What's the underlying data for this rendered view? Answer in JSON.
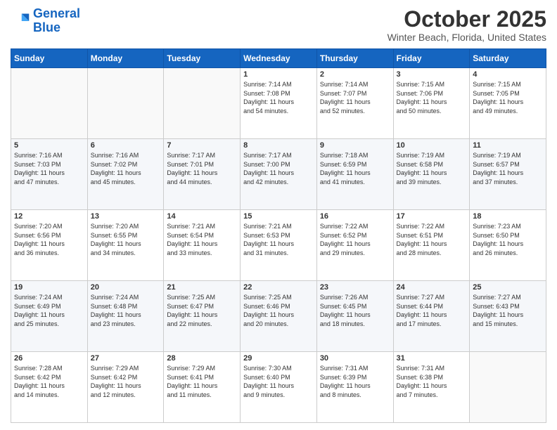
{
  "header": {
    "logo_line1": "General",
    "logo_line2": "Blue",
    "month": "October 2025",
    "location": "Winter Beach, Florida, United States"
  },
  "weekdays": [
    "Sunday",
    "Monday",
    "Tuesday",
    "Wednesday",
    "Thursday",
    "Friday",
    "Saturday"
  ],
  "weeks": [
    [
      {
        "day": "",
        "info": ""
      },
      {
        "day": "",
        "info": ""
      },
      {
        "day": "",
        "info": ""
      },
      {
        "day": "1",
        "info": "Sunrise: 7:14 AM\nSunset: 7:08 PM\nDaylight: 11 hours\nand 54 minutes."
      },
      {
        "day": "2",
        "info": "Sunrise: 7:14 AM\nSunset: 7:07 PM\nDaylight: 11 hours\nand 52 minutes."
      },
      {
        "day": "3",
        "info": "Sunrise: 7:15 AM\nSunset: 7:06 PM\nDaylight: 11 hours\nand 50 minutes."
      },
      {
        "day": "4",
        "info": "Sunrise: 7:15 AM\nSunset: 7:05 PM\nDaylight: 11 hours\nand 49 minutes."
      }
    ],
    [
      {
        "day": "5",
        "info": "Sunrise: 7:16 AM\nSunset: 7:03 PM\nDaylight: 11 hours\nand 47 minutes."
      },
      {
        "day": "6",
        "info": "Sunrise: 7:16 AM\nSunset: 7:02 PM\nDaylight: 11 hours\nand 45 minutes."
      },
      {
        "day": "7",
        "info": "Sunrise: 7:17 AM\nSunset: 7:01 PM\nDaylight: 11 hours\nand 44 minutes."
      },
      {
        "day": "8",
        "info": "Sunrise: 7:17 AM\nSunset: 7:00 PM\nDaylight: 11 hours\nand 42 minutes."
      },
      {
        "day": "9",
        "info": "Sunrise: 7:18 AM\nSunset: 6:59 PM\nDaylight: 11 hours\nand 41 minutes."
      },
      {
        "day": "10",
        "info": "Sunrise: 7:19 AM\nSunset: 6:58 PM\nDaylight: 11 hours\nand 39 minutes."
      },
      {
        "day": "11",
        "info": "Sunrise: 7:19 AM\nSunset: 6:57 PM\nDaylight: 11 hours\nand 37 minutes."
      }
    ],
    [
      {
        "day": "12",
        "info": "Sunrise: 7:20 AM\nSunset: 6:56 PM\nDaylight: 11 hours\nand 36 minutes."
      },
      {
        "day": "13",
        "info": "Sunrise: 7:20 AM\nSunset: 6:55 PM\nDaylight: 11 hours\nand 34 minutes."
      },
      {
        "day": "14",
        "info": "Sunrise: 7:21 AM\nSunset: 6:54 PM\nDaylight: 11 hours\nand 33 minutes."
      },
      {
        "day": "15",
        "info": "Sunrise: 7:21 AM\nSunset: 6:53 PM\nDaylight: 11 hours\nand 31 minutes."
      },
      {
        "day": "16",
        "info": "Sunrise: 7:22 AM\nSunset: 6:52 PM\nDaylight: 11 hours\nand 29 minutes."
      },
      {
        "day": "17",
        "info": "Sunrise: 7:22 AM\nSunset: 6:51 PM\nDaylight: 11 hours\nand 28 minutes."
      },
      {
        "day": "18",
        "info": "Sunrise: 7:23 AM\nSunset: 6:50 PM\nDaylight: 11 hours\nand 26 minutes."
      }
    ],
    [
      {
        "day": "19",
        "info": "Sunrise: 7:24 AM\nSunset: 6:49 PM\nDaylight: 11 hours\nand 25 minutes."
      },
      {
        "day": "20",
        "info": "Sunrise: 7:24 AM\nSunset: 6:48 PM\nDaylight: 11 hours\nand 23 minutes."
      },
      {
        "day": "21",
        "info": "Sunrise: 7:25 AM\nSunset: 6:47 PM\nDaylight: 11 hours\nand 22 minutes."
      },
      {
        "day": "22",
        "info": "Sunrise: 7:25 AM\nSunset: 6:46 PM\nDaylight: 11 hours\nand 20 minutes."
      },
      {
        "day": "23",
        "info": "Sunrise: 7:26 AM\nSunset: 6:45 PM\nDaylight: 11 hours\nand 18 minutes."
      },
      {
        "day": "24",
        "info": "Sunrise: 7:27 AM\nSunset: 6:44 PM\nDaylight: 11 hours\nand 17 minutes."
      },
      {
        "day": "25",
        "info": "Sunrise: 7:27 AM\nSunset: 6:43 PM\nDaylight: 11 hours\nand 15 minutes."
      }
    ],
    [
      {
        "day": "26",
        "info": "Sunrise: 7:28 AM\nSunset: 6:42 PM\nDaylight: 11 hours\nand 14 minutes."
      },
      {
        "day": "27",
        "info": "Sunrise: 7:29 AM\nSunset: 6:42 PM\nDaylight: 11 hours\nand 12 minutes."
      },
      {
        "day": "28",
        "info": "Sunrise: 7:29 AM\nSunset: 6:41 PM\nDaylight: 11 hours\nand 11 minutes."
      },
      {
        "day": "29",
        "info": "Sunrise: 7:30 AM\nSunset: 6:40 PM\nDaylight: 11 hours\nand 9 minutes."
      },
      {
        "day": "30",
        "info": "Sunrise: 7:31 AM\nSunset: 6:39 PM\nDaylight: 11 hours\nand 8 minutes."
      },
      {
        "day": "31",
        "info": "Sunrise: 7:31 AM\nSunset: 6:38 PM\nDaylight: 11 hours\nand 7 minutes."
      },
      {
        "day": "",
        "info": ""
      }
    ]
  ]
}
